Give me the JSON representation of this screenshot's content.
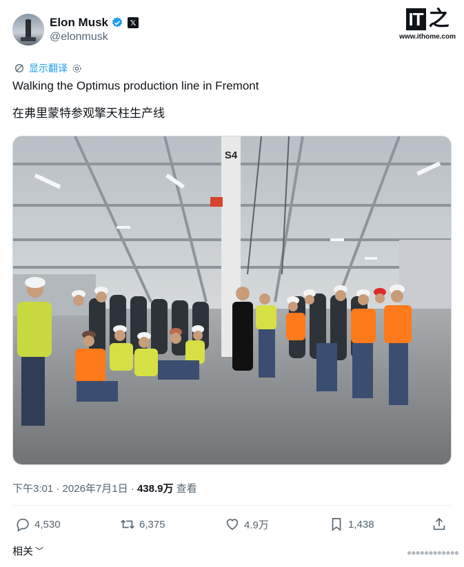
{
  "author": {
    "display_name": "Elon Musk",
    "handle": "@elonmusk"
  },
  "watermark_logo": {
    "mark": "IT",
    "glyph": "之",
    "url": "www.ithome.com"
  },
  "translate": {
    "label": "显示翻译"
  },
  "tweet": {
    "text_en": "Walking the Optimus production line in Fremont",
    "text_zh": "在弗里蒙特参观擎天柱生产线",
    "pillar_label": "S4"
  },
  "meta": {
    "time": "下午3:01",
    "sep1": " · ",
    "date": "2026年7月1日",
    "sep2": " · ",
    "views_count": "438.9万",
    "views_label": " 查看"
  },
  "actions": {
    "reply": "4,530",
    "retweet": "6,375",
    "like": "4.9万",
    "bookmark": "1,438"
  },
  "related": {
    "label": "相关"
  },
  "colors": {
    "accent": "#1d9bf0",
    "text": "#0f1419",
    "secondary": "#536471"
  },
  "icons": [
    "verified-icon",
    "x-affiliate-icon",
    "translate-icon",
    "gear-icon",
    "reply-icon",
    "retweet-icon",
    "like-icon",
    "bookmark-icon",
    "share-icon",
    "chevron-down-icon"
  ]
}
